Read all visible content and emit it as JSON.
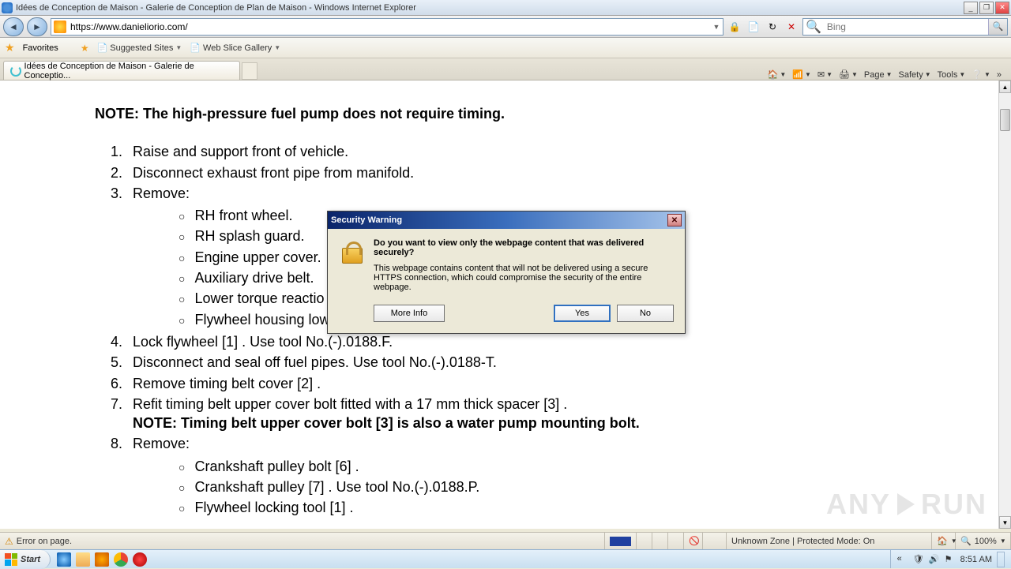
{
  "window": {
    "title": "Idées de Conception de Maison - Galerie de Conception de Plan de Maison - Windows Internet Explorer"
  },
  "nav": {
    "url": "https://www.danieliorio.com/",
    "search_placeholder": "Bing"
  },
  "favbar": {
    "favorites": "Favorites",
    "suggested": "Suggested Sites",
    "webslice": "Web Slice Gallery"
  },
  "tab": {
    "title": "Idées de Conception de Maison - Galerie de Conceptio..."
  },
  "cmdbar": {
    "page": "Page",
    "safety": "Safety",
    "tools": "Tools"
  },
  "doc": {
    "note": "NOTE: The high-pressure fuel pump does not require timing.",
    "li1": "Raise and support front of vehicle.",
    "li2": "Disconnect exhaust front pipe from manifold.",
    "li3": "Remove:",
    "sub3": {
      "a": "RH front wheel.",
      "b": "RH splash guard.",
      "c": "Engine upper cover.",
      "d": "Auxiliary drive belt.",
      "e": "Lower torque reactio",
      "f": "Flywheel housing low"
    },
    "li4": "Lock flywheel [1] . Use tool No.(-).0188.F.",
    "li5": "Disconnect and seal off fuel pipes. Use tool No.(-).0188-T.",
    "li6": "Remove timing belt cover [2] .",
    "li7": "Refit timing belt upper cover bolt fitted with a 17 mm thick spacer [3] .",
    "note2": "NOTE: Timing belt upper cover bolt [3] is also a water pump mounting bolt.",
    "li8": "Remove:",
    "sub8": {
      "a": "Crankshaft pulley bolt [6] .",
      "b": "Crankshaft pulley [7] . Use tool No.(-).0188.P.",
      "c": "Flywheel locking tool [1] ."
    }
  },
  "dialog": {
    "title": "Security Warning",
    "question": "Do you want to view only the webpage content that was delivered securely?",
    "detail": "This webpage contains content that will not be delivered using a secure HTTPS connection, which could compromise the security of the entire webpage.",
    "more": "More Info",
    "yes": "Yes",
    "no": "No"
  },
  "status": {
    "error": "Error on page.",
    "zone": "Unknown Zone | Protected Mode: On",
    "zoom": "100%"
  },
  "taskbar": {
    "start": "Start",
    "time": "8:51 AM"
  },
  "watermark": {
    "text1": "ANY",
    "text2": "RUN"
  }
}
